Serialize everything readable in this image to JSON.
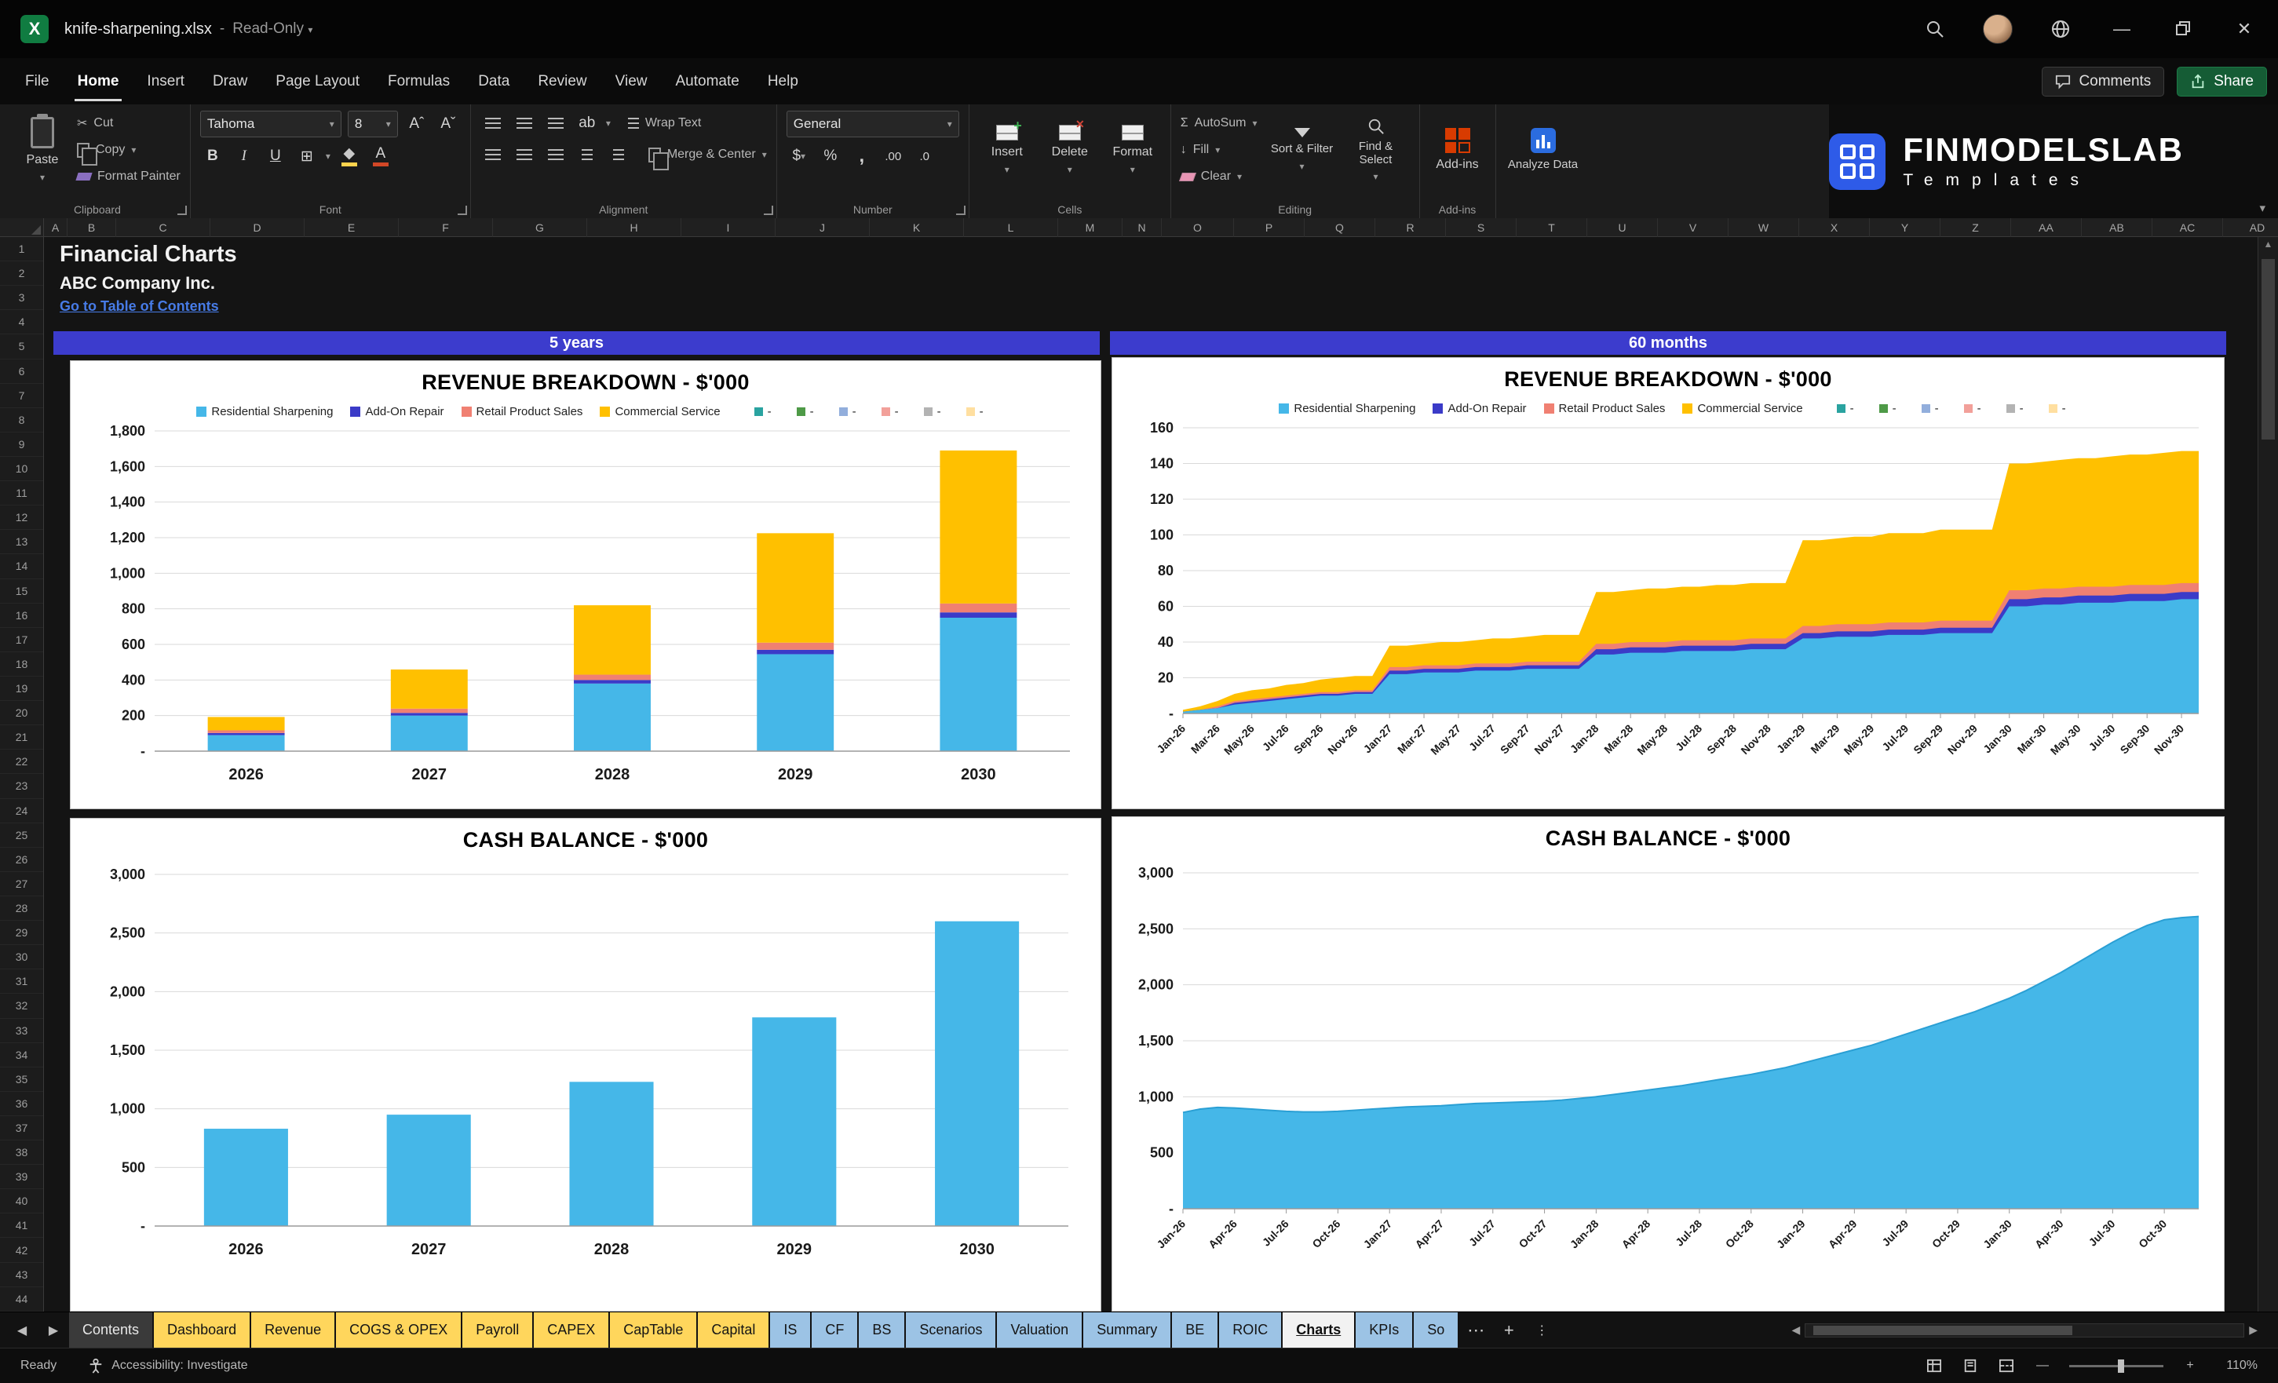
{
  "titlebar": {
    "filename": "knife-sharpening.xlsx",
    "sep": "-",
    "mode": "Read-Only"
  },
  "icons": {
    "excel-logo": "X",
    "minimize": "—",
    "close": "✕",
    "chevron": "▾",
    "nav-left": "◀",
    "nav-right": "▶",
    "more": "⋯",
    "kebab": "⋮",
    "add": "+",
    "cut": "✂",
    "autosum": "Σ",
    "scroll-up": "▲",
    "fill-arrow": "↓",
    "dollar": "$",
    "percent": "%",
    "comma": ",",
    "increase-decimal": ".00",
    "decrease-decimal": ".0",
    "bold": "B",
    "italic": "I",
    "underline": "U",
    "font-color": "A"
  },
  "menubar": {
    "items": [
      "File",
      "Home",
      "Insert",
      "Draw",
      "Page Layout",
      "Formulas",
      "Data",
      "Review",
      "View",
      "Automate",
      "Help"
    ],
    "active_index": 1,
    "comments": "Comments",
    "share": "Share"
  },
  "ribbon": {
    "clipboard": {
      "label": "Clipboard",
      "paste": "Paste",
      "cut": "Cut",
      "copy": "Copy",
      "format_painter": "Format Painter"
    },
    "font": {
      "label": "Font",
      "family": "Tahoma",
      "size": "8"
    },
    "alignment": {
      "label": "Alignment",
      "wrap_text": "Wrap Text",
      "merge_center": "Merge & Center"
    },
    "number": {
      "label": "Number",
      "format": "General"
    },
    "cells": {
      "label": "Cells",
      "insert": "Insert",
      "delete": "Delete",
      "format": "Format"
    },
    "editing": {
      "label": "Editing",
      "autosum": "AutoSum",
      "fill": "Fill",
      "clear": "Clear",
      "sort_filter": "Sort & Filter",
      "find_select": "Find & Select"
    },
    "addins_label": "Add-ins",
    "analyze": "Analyze Data",
    "brand": {
      "name": "FINMODELSLAB",
      "subtitle": "Templates"
    }
  },
  "grid": {
    "columns": [
      "A",
      "B",
      "C",
      "D",
      "E",
      "F",
      "G",
      "H",
      "I",
      "J",
      "K",
      "L",
      "M",
      "N",
      "O",
      "P",
      "Q",
      "R",
      "S",
      "T",
      "U",
      "V",
      "W",
      "X",
      "Y",
      "Z",
      "AA",
      "AB",
      "AC",
      "AD"
    ],
    "rows": [
      1,
      2,
      3,
      4,
      5,
      6,
      7,
      8,
      9,
      10,
      11,
      12,
      13,
      14,
      15,
      16,
      17,
      18,
      19,
      20,
      21,
      22,
      23,
      24,
      25,
      26,
      27,
      28,
      29,
      30,
      31,
      32,
      33,
      34,
      35,
      36,
      37,
      38,
      39,
      40,
      41,
      42,
      43,
      44
    ],
    "title": "Financial Charts",
    "company": "ABC Company Inc.",
    "link": "Go to Table of Contents",
    "band_left": "5 years",
    "band_right": "60 months"
  },
  "sheet_tabs": {
    "tabs": [
      {
        "label": "Contents",
        "style": "dark"
      },
      {
        "label": "Dashboard",
        "style": "yellow"
      },
      {
        "label": "Revenue",
        "style": "yellow"
      },
      {
        "label": "COGS & OPEX",
        "style": "yellow"
      },
      {
        "label": "Payroll",
        "style": "yellow"
      },
      {
        "label": "CAPEX",
        "style": "yellow"
      },
      {
        "label": "CapTable",
        "style": "yellow"
      },
      {
        "label": "Capital",
        "style": "yellow"
      },
      {
        "label": "IS",
        "style": "blue"
      },
      {
        "label": "CF",
        "style": "blue"
      },
      {
        "label": "BS",
        "style": "blue"
      },
      {
        "label": "Scenarios",
        "style": "blue"
      },
      {
        "label": "Valuation",
        "style": "blue"
      },
      {
        "label": "Summary",
        "style": "blue"
      },
      {
        "label": "BE",
        "style": "blue"
      },
      {
        "label": "ROIC",
        "style": "blue"
      },
      {
        "label": "Charts",
        "style": "active"
      },
      {
        "label": "KPIs",
        "style": "blue"
      },
      {
        "label": "So",
        "style": "blue"
      }
    ]
  },
  "statusbar": {
    "ready": "Ready",
    "accessibility": "Accessibility: Investigate",
    "zoom": "110%"
  },
  "chart_data": [
    {
      "type": "stacked-bar",
      "title": "REVENUE BREAKDOWN - $'000",
      "categories": [
        "2026",
        "2027",
        "2028",
        "2029",
        "2030"
      ],
      "series": [
        {
          "name": "Residential Sharpening",
          "color": "#45B7E8",
          "values": [
            90,
            200,
            380,
            545,
            750
          ]
        },
        {
          "name": "Add-On Repair",
          "color": "#3B3BC8",
          "values": [
            12,
            15,
            20,
            25,
            30
          ]
        },
        {
          "name": "Retail Product Sales",
          "color": "#F08072",
          "values": [
            15,
            24,
            30,
            40,
            50
          ]
        },
        {
          "name": "Commercial Service",
          "color": "#FFC000",
          "values": [
            75,
            220,
            390,
            615,
            860
          ]
        }
      ],
      "extra_legend": [
        {
          "label": "-",
          "color": "#2AA3A0"
        },
        {
          "label": "-",
          "color": "#4E9A47"
        },
        {
          "label": "-",
          "color": "#92AEDC"
        },
        {
          "label": "-",
          "color": "#F2A09A"
        },
        {
          "label": "-",
          "color": "#B3B3B3"
        },
        {
          "label": "-",
          "color": "#FFDFA0"
        }
      ],
      "ylim": [
        0,
        1800
      ],
      "ytick": 200,
      "grid": true,
      "legend_position": "top"
    },
    {
      "type": "stacked-area",
      "title": "REVENUE BREAKDOWN - $'000",
      "x": [
        "Jan-26",
        "Feb-26",
        "Mar-26",
        "Apr-26",
        "May-26",
        "Jun-26",
        "Jul-26",
        "Aug-26",
        "Sep-26",
        "Oct-26",
        "Nov-26",
        "Dec-26",
        "Jan-27",
        "Feb-27",
        "Mar-27",
        "Apr-27",
        "May-27",
        "Jun-27",
        "Jul-27",
        "Aug-27",
        "Sep-27",
        "Oct-27",
        "Nov-27",
        "Dec-27",
        "Jan-28",
        "Feb-28",
        "Mar-28",
        "Apr-28",
        "May-28",
        "Jun-28",
        "Jul-28",
        "Aug-28",
        "Sep-28",
        "Oct-28",
        "Nov-28",
        "Dec-28",
        "Jan-29",
        "Feb-29",
        "Mar-29",
        "Apr-29",
        "May-29",
        "Jun-29",
        "Jul-29",
        "Aug-29",
        "Sep-29",
        "Oct-29",
        "Nov-29",
        "Dec-29",
        "Jan-30",
        "Feb-30",
        "Mar-30",
        "Apr-30",
        "May-30",
        "Jun-30",
        "Jul-30",
        "Aug-30",
        "Sep-30",
        "Oct-30",
        "Nov-30",
        "Dec-30"
      ],
      "tick_every": 2,
      "series": [
        {
          "name": "Residential Sharpening",
          "color": "#45B7E8",
          "values": [
            1,
            2,
            3,
            5,
            6,
            7,
            8,
            9,
            10,
            10,
            11,
            11,
            22,
            22,
            23,
            23,
            23,
            24,
            24,
            24,
            25,
            25,
            25,
            25,
            33,
            33,
            34,
            34,
            34,
            35,
            35,
            35,
            35,
            36,
            36,
            36,
            42,
            42,
            43,
            43,
            43,
            44,
            44,
            44,
            45,
            45,
            45,
            45,
            60,
            60,
            61,
            61,
            62,
            62,
            62,
            63,
            63,
            63,
            64,
            64
          ]
        },
        {
          "name": "Add-On Repair",
          "color": "#3B3BC8",
          "values": [
            0,
            0,
            0,
            1,
            1,
            1,
            1,
            1,
            1,
            1,
            1,
            1,
            2,
            2,
            2,
            2,
            2,
            2,
            2,
            2,
            2,
            2,
            2,
            2,
            3,
            3,
            3,
            3,
            3,
            3,
            3,
            3,
            3,
            3,
            3,
            3,
            3,
            3,
            3,
            3,
            3,
            3,
            3,
            3,
            3,
            3,
            3,
            3,
            4,
            4,
            4,
            4,
            4,
            4,
            4,
            4,
            4,
            4,
            4,
            4
          ]
        },
        {
          "name": "Retail Product Sales",
          "color": "#F08072",
          "values": [
            0,
            0,
            1,
            1,
            1,
            1,
            1,
            1,
            1,
            1,
            1,
            1,
            2,
            2,
            2,
            2,
            2,
            2,
            2,
            2,
            2,
            2,
            2,
            2,
            3,
            3,
            3,
            3,
            3,
            3,
            3,
            3,
            3,
            3,
            3,
            3,
            4,
            4,
            4,
            4,
            4,
            4,
            4,
            4,
            4,
            4,
            4,
            4,
            5,
            5,
            5,
            5,
            5,
            5,
            5,
            5,
            5,
            5,
            5,
            5
          ]
        },
        {
          "name": "Commercial Service",
          "color": "#FFC000",
          "values": [
            1,
            2,
            3,
            4,
            5,
            5,
            6,
            6,
            7,
            8,
            8,
            8,
            12,
            12,
            12,
            13,
            13,
            13,
            14,
            14,
            14,
            15,
            15,
            15,
            29,
            29,
            29,
            30,
            30,
            30,
            30,
            31,
            31,
            31,
            31,
            31,
            48,
            48,
            48,
            49,
            49,
            50,
            50,
            50,
            51,
            51,
            51,
            51,
            71,
            71,
            71,
            72,
            72,
            72,
            73,
            73,
            73,
            74,
            74,
            74
          ]
        }
      ],
      "extra_legend": [
        {
          "label": "-",
          "color": "#2AA3A0"
        },
        {
          "label": "-",
          "color": "#4E9A47"
        },
        {
          "label": "-",
          "color": "#92AEDC"
        },
        {
          "label": "-",
          "color": "#F2A09A"
        },
        {
          "label": "-",
          "color": "#B3B3B3"
        },
        {
          "label": "-",
          "color": "#FFDFA0"
        }
      ],
      "ylim": [
        0,
        160
      ],
      "ytick": 20,
      "grid": true,
      "legend_position": "top"
    },
    {
      "type": "bar",
      "title": "CASH BALANCE - $'000",
      "categories": [
        "2026",
        "2027",
        "2028",
        "2029",
        "2030"
      ],
      "color": "#45B7E8",
      "values": [
        830,
        950,
        1230,
        1780,
        2600
      ],
      "ylim": [
        0,
        3000
      ],
      "ytick": 500,
      "grid": true,
      "legend_position": "none"
    },
    {
      "type": "area",
      "title": "CASH BALANCE - $'000",
      "x": [
        "Jan-26",
        "Feb-26",
        "Mar-26",
        "Apr-26",
        "May-26",
        "Jun-26",
        "Jul-26",
        "Aug-26",
        "Sep-26",
        "Oct-26",
        "Nov-26",
        "Dec-26",
        "Jan-27",
        "Feb-27",
        "Mar-27",
        "Apr-27",
        "May-27",
        "Jun-27",
        "Jul-27",
        "Aug-27",
        "Sep-27",
        "Oct-27",
        "Nov-27",
        "Dec-27",
        "Jan-28",
        "Feb-28",
        "Mar-28",
        "Apr-28",
        "May-28",
        "Jun-28",
        "Jul-28",
        "Aug-28",
        "Sep-28",
        "Oct-28",
        "Nov-28",
        "Dec-28",
        "Jan-29",
        "Feb-29",
        "Mar-29",
        "Apr-29",
        "May-29",
        "Jun-29",
        "Jul-29",
        "Aug-29",
        "Sep-29",
        "Oct-29",
        "Nov-29",
        "Dec-29",
        "Jan-30",
        "Feb-30",
        "Mar-30",
        "Apr-30",
        "May-30",
        "Jun-30",
        "Jul-30",
        "Aug-30",
        "Sep-30",
        "Oct-30",
        "Nov-30",
        "Dec-30"
      ],
      "tick_every": 3,
      "color": "#45B7E8",
      "values": [
        860,
        890,
        905,
        900,
        890,
        880,
        870,
        865,
        865,
        870,
        880,
        890,
        900,
        910,
        915,
        920,
        930,
        940,
        945,
        950,
        955,
        960,
        970,
        985,
        1000,
        1020,
        1040,
        1060,
        1080,
        1100,
        1125,
        1150,
        1175,
        1200,
        1230,
        1260,
        1300,
        1340,
        1380,
        1420,
        1460,
        1510,
        1560,
        1610,
        1660,
        1710,
        1760,
        1820,
        1880,
        1950,
        2030,
        2110,
        2200,
        2290,
        2380,
        2460,
        2530,
        2580,
        2600,
        2610
      ],
      "ylim": [
        0,
        3000
      ],
      "ytick": 500,
      "grid": true,
      "legend_position": "none"
    }
  ]
}
